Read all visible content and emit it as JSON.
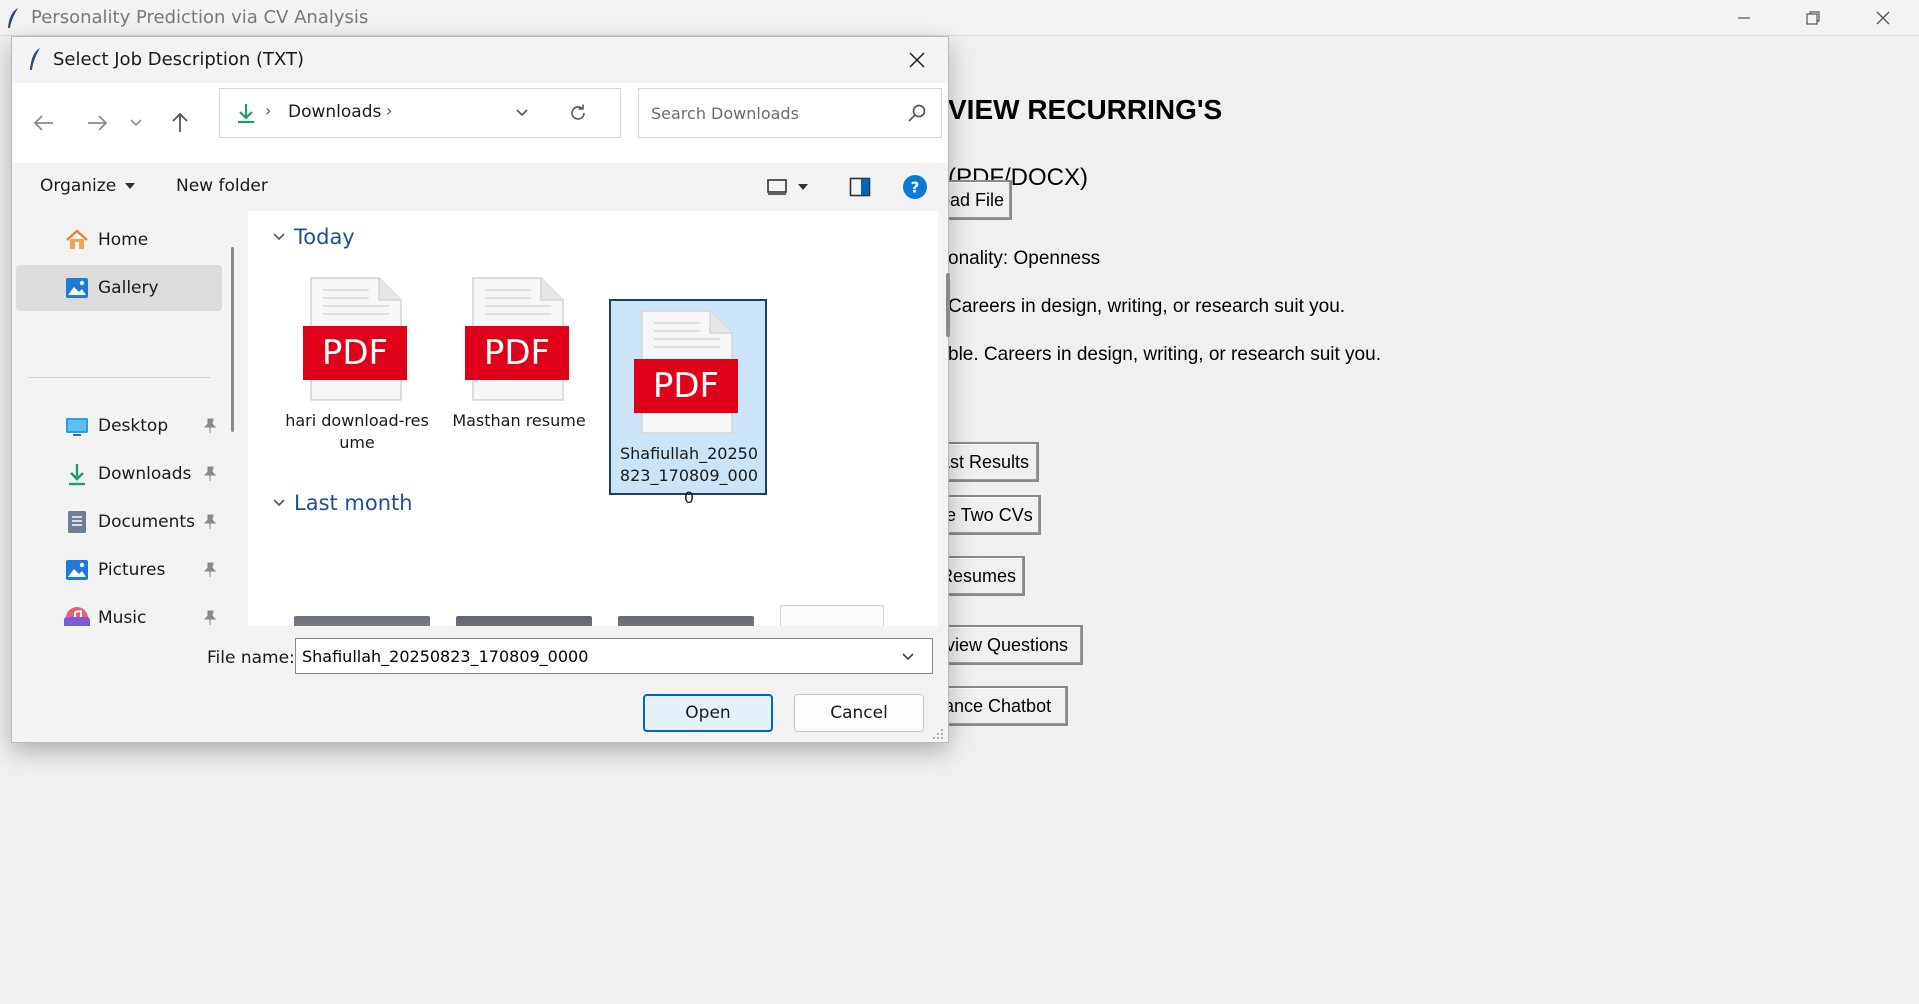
{
  "app": {
    "title": "Personality Prediction via CV Analysis",
    "heading": "VIEW RECURRING'S",
    "upload_label": "(PDF/DOCX)",
    "upload_button": "oad File",
    "personality_text": "onality: Openness",
    "career_text_1": "Careers in design, writing, or research suit you.",
    "career_text_2": "ble. Careers in design, writing, or research suit you.",
    "buttons": [
      "ast Results",
      "re Two CVs",
      "Resumes",
      "rview Questions",
      "lance Chatbot"
    ],
    "window_controls": {
      "minimize": "minimize-icon",
      "maximize": "restore-icon",
      "close": "close-icon"
    }
  },
  "dialog": {
    "title": "Select Job Description (TXT)",
    "address": {
      "location": "Downloads"
    },
    "search": {
      "placeholder": "Search Downloads"
    },
    "toolbar": {
      "organize": "Organize",
      "new_folder": "New folder"
    },
    "nav_items": [
      {
        "label": "Home",
        "icon": "home-icon",
        "selected": false
      },
      {
        "label": "Gallery",
        "icon": "gallery-icon",
        "selected": true
      },
      {
        "label": "Desktop",
        "icon": "desktop-icon",
        "pinned": true
      },
      {
        "label": "Downloads",
        "icon": "downloads-icon",
        "pinned": true
      },
      {
        "label": "Documents",
        "icon": "documents-icon",
        "pinned": true
      },
      {
        "label": "Pictures",
        "icon": "pictures-icon",
        "pinned": true
      },
      {
        "label": "Music",
        "icon": "music-icon",
        "pinned": true
      }
    ],
    "groups": [
      {
        "label": "Today",
        "files": [
          {
            "name": "hari download-resume",
            "type": "PDF",
            "selected": false
          },
          {
            "name": "Masthan resume",
            "type": "PDF",
            "selected": false
          },
          {
            "name": "Shafiullah_20250823_170809_0000",
            "type": "PDF",
            "selected": true
          }
        ]
      },
      {
        "label": "Last month",
        "files": []
      }
    ],
    "file_name": {
      "label": "File name:",
      "value": "Shafiullah_20250823_170809_0000"
    },
    "buttons": {
      "open": "Open",
      "cancel": "Cancel"
    },
    "colors": {
      "accent": "#0067c0",
      "pdf_red": "#e1001a",
      "selection": "#cce4f7",
      "group_header": "#1f4e99"
    }
  }
}
